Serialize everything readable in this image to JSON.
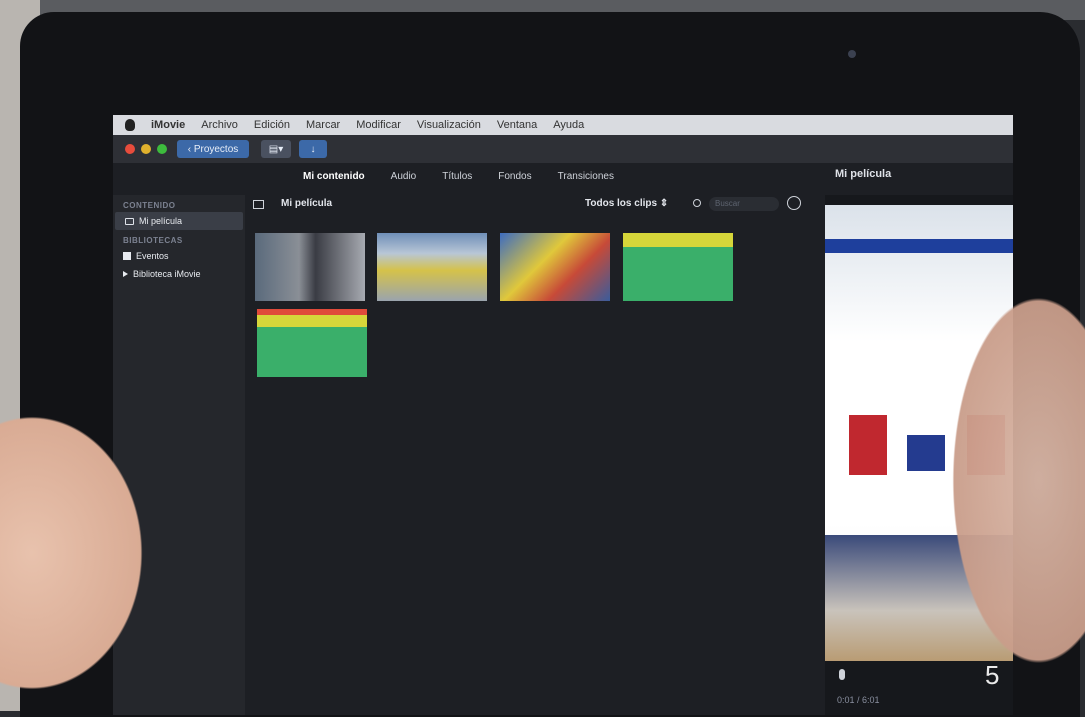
{
  "menubar": {
    "app_name": "iMovie",
    "items": [
      "Archivo",
      "Edición",
      "Marcar",
      "Modificar",
      "Visualización",
      "Ventana",
      "Ayuda"
    ]
  },
  "toolbar": {
    "projects_label": "Proyectos",
    "viewer_title": "Mi película"
  },
  "tabs": [
    {
      "label": "Mi contenido",
      "active": true
    },
    {
      "label": "Audio",
      "active": false
    },
    {
      "label": "Títulos",
      "active": false
    },
    {
      "label": "Fondos",
      "active": false
    },
    {
      "label": "Transiciones",
      "active": false
    }
  ],
  "sidebar": {
    "content_header": "CONTENIDO",
    "project_item": "Mi película",
    "libraries_header": "BIBLIOTECAS",
    "events_item": "Eventos",
    "library_item": "Biblioteca iMovie"
  },
  "browser": {
    "title": "Mi película",
    "filter_label": "Todos los clips ⇕",
    "search_placeholder": "Buscar"
  },
  "viewer": {
    "timecode": "0:01 / 6:01"
  },
  "page_number": "5"
}
